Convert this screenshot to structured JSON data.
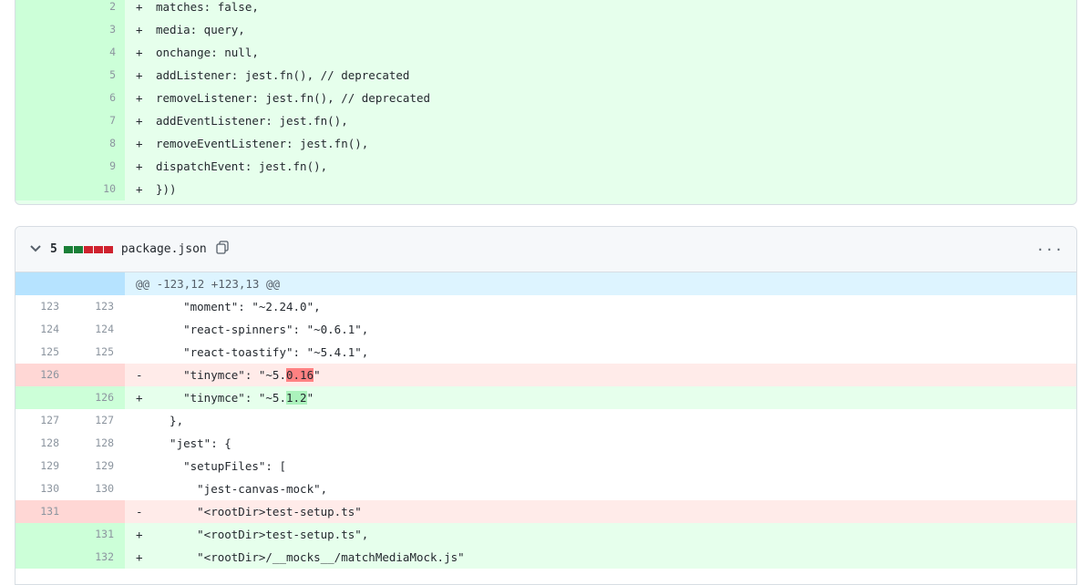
{
  "file1": {
    "lines": [
      {
        "num": "2",
        "sign": "+",
        "text": "matches: false,"
      },
      {
        "num": "3",
        "sign": "+",
        "text": "media: query,"
      },
      {
        "num": "4",
        "sign": "+",
        "text": "onchange: null,"
      },
      {
        "num": "5",
        "sign": "+",
        "text": "addListener: jest.fn(), // deprecated"
      },
      {
        "num": "6",
        "sign": "+",
        "text": "removeListener: jest.fn(), // deprecated"
      },
      {
        "num": "7",
        "sign": "+",
        "text": "addEventListener: jest.fn(),"
      },
      {
        "num": "8",
        "sign": "+",
        "text": "removeEventListener: jest.fn(),"
      },
      {
        "num": "9",
        "sign": "+",
        "text": "dispatchEvent: jest.fn(),"
      },
      {
        "num": "10",
        "sign": "+",
        "text": "}))"
      }
    ]
  },
  "file2": {
    "change_count": "5",
    "filename": "package.json",
    "copy_icon": "copy-icon",
    "more_icon": "···",
    "diffstat_colors": [
      "#1a7f37",
      "#1a7f37",
      "#cf222e",
      "#cf222e",
      "#cf222e"
    ],
    "hunk_header": "@@ -123,12 +123,13 @@",
    "lines": [
      {
        "type": "ctx",
        "old": "123",
        "new": "123",
        "sign": "",
        "pre": "    \"moment\": \"~2.24.0\",",
        "hl": "",
        "post": ""
      },
      {
        "type": "ctx",
        "old": "124",
        "new": "124",
        "sign": "",
        "pre": "    \"react-spinners\": \"~0.6.1\",",
        "hl": "",
        "post": ""
      },
      {
        "type": "ctx",
        "old": "125",
        "new": "125",
        "sign": "",
        "pre": "    \"react-toastify\": \"~5.4.1\",",
        "hl": "",
        "post": ""
      },
      {
        "type": "del",
        "old": "126",
        "new": "",
        "sign": "-",
        "pre": "    \"tinymce\": \"~5.",
        "hl": "0.16",
        "post": "\""
      },
      {
        "type": "add",
        "old": "",
        "new": "126",
        "sign": "+",
        "pre": "    \"tinymce\": \"~5.",
        "hl": "1.2",
        "post": "\""
      },
      {
        "type": "ctx",
        "old": "127",
        "new": "127",
        "sign": "",
        "pre": "  },",
        "hl": "",
        "post": ""
      },
      {
        "type": "ctx",
        "old": "128",
        "new": "128",
        "sign": "",
        "pre": "  \"jest\": {",
        "hl": "",
        "post": ""
      },
      {
        "type": "ctx",
        "old": "129",
        "new": "129",
        "sign": "",
        "pre": "    \"setupFiles\": [",
        "hl": "",
        "post": ""
      },
      {
        "type": "ctx",
        "old": "130",
        "new": "130",
        "sign": "",
        "pre": "      \"jest-canvas-mock\",",
        "hl": "",
        "post": ""
      },
      {
        "type": "del",
        "old": "131",
        "new": "",
        "sign": "-",
        "pre": "      \"<rootDir>test-setup.ts\"",
        "hl": "",
        "post": ""
      },
      {
        "type": "add",
        "old": "",
        "new": "131",
        "sign": "+",
        "pre": "      \"<rootDir>test-setup.ts\",",
        "hl": "",
        "post": ""
      },
      {
        "type": "add",
        "old": "",
        "new": "132",
        "sign": "+",
        "pre": "      \"<rootDir>/__mocks__/matchMediaMock.js\"",
        "hl": "",
        "post": ""
      }
    ]
  }
}
